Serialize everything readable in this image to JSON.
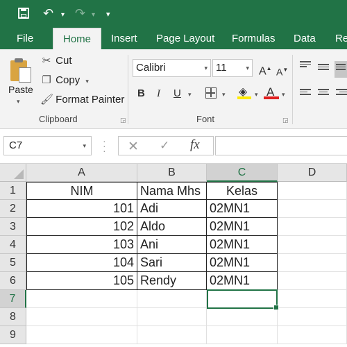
{
  "quick_access": {
    "save_icon": "save-icon",
    "undo_icon": "undo-icon",
    "redo_icon": "redo-icon",
    "customize_icon": "customize-qat-icon"
  },
  "tabs": [
    {
      "label": "File"
    },
    {
      "label": "Home",
      "active": true
    },
    {
      "label": "Insert"
    },
    {
      "label": "Page Layout"
    },
    {
      "label": "Formulas"
    },
    {
      "label": "Data"
    },
    {
      "label": "Re"
    }
  ],
  "clipboard": {
    "paste_label": "Paste",
    "cut_label": "Cut",
    "copy_label": "Copy",
    "format_painter_label": "Format Painter",
    "group_label": "Clipboard"
  },
  "font": {
    "family": "Calibri",
    "size": "11",
    "grow_label": "A",
    "shrink_label": "A",
    "bold_label": "B",
    "italic_label": "I",
    "underline_label": "U",
    "font_color_label": "A",
    "group_label": "Font",
    "fill_color": "#ffeb00",
    "font_color": "#e02020"
  },
  "formula_bar": {
    "name_box": "C7",
    "cancel_glyph": "✕",
    "enter_glyph": "✓",
    "fx_label": "fx",
    "value": ""
  },
  "sheet": {
    "columns": [
      "A",
      "B",
      "C",
      "D"
    ],
    "selected_column": "C",
    "rows": [
      "1",
      "2",
      "3",
      "4",
      "5",
      "6",
      "7",
      "8",
      "9"
    ],
    "selected_row": "7",
    "headers": {
      "a": "NIM",
      "b": "Nama Mhs",
      "c": "Kelas"
    },
    "records": [
      {
        "nim": "101",
        "nama": "Adi",
        "kelas": "02MN1"
      },
      {
        "nim": "102",
        "nama": "Aldo",
        "kelas": "02MN1"
      },
      {
        "nim": "103",
        "nama": "Ani",
        "kelas": "02MN1"
      },
      {
        "nim": "104",
        "nama": "Sari",
        "kelas": "02MN1"
      },
      {
        "nim": "105",
        "nama": "Rendy",
        "kelas": "02MN1"
      }
    ],
    "active_cell": "C7"
  },
  "colors": {
    "accent": "#217346",
    "ribbon_bg": "#f3f3f3",
    "header_bg": "#e6e6e6"
  }
}
